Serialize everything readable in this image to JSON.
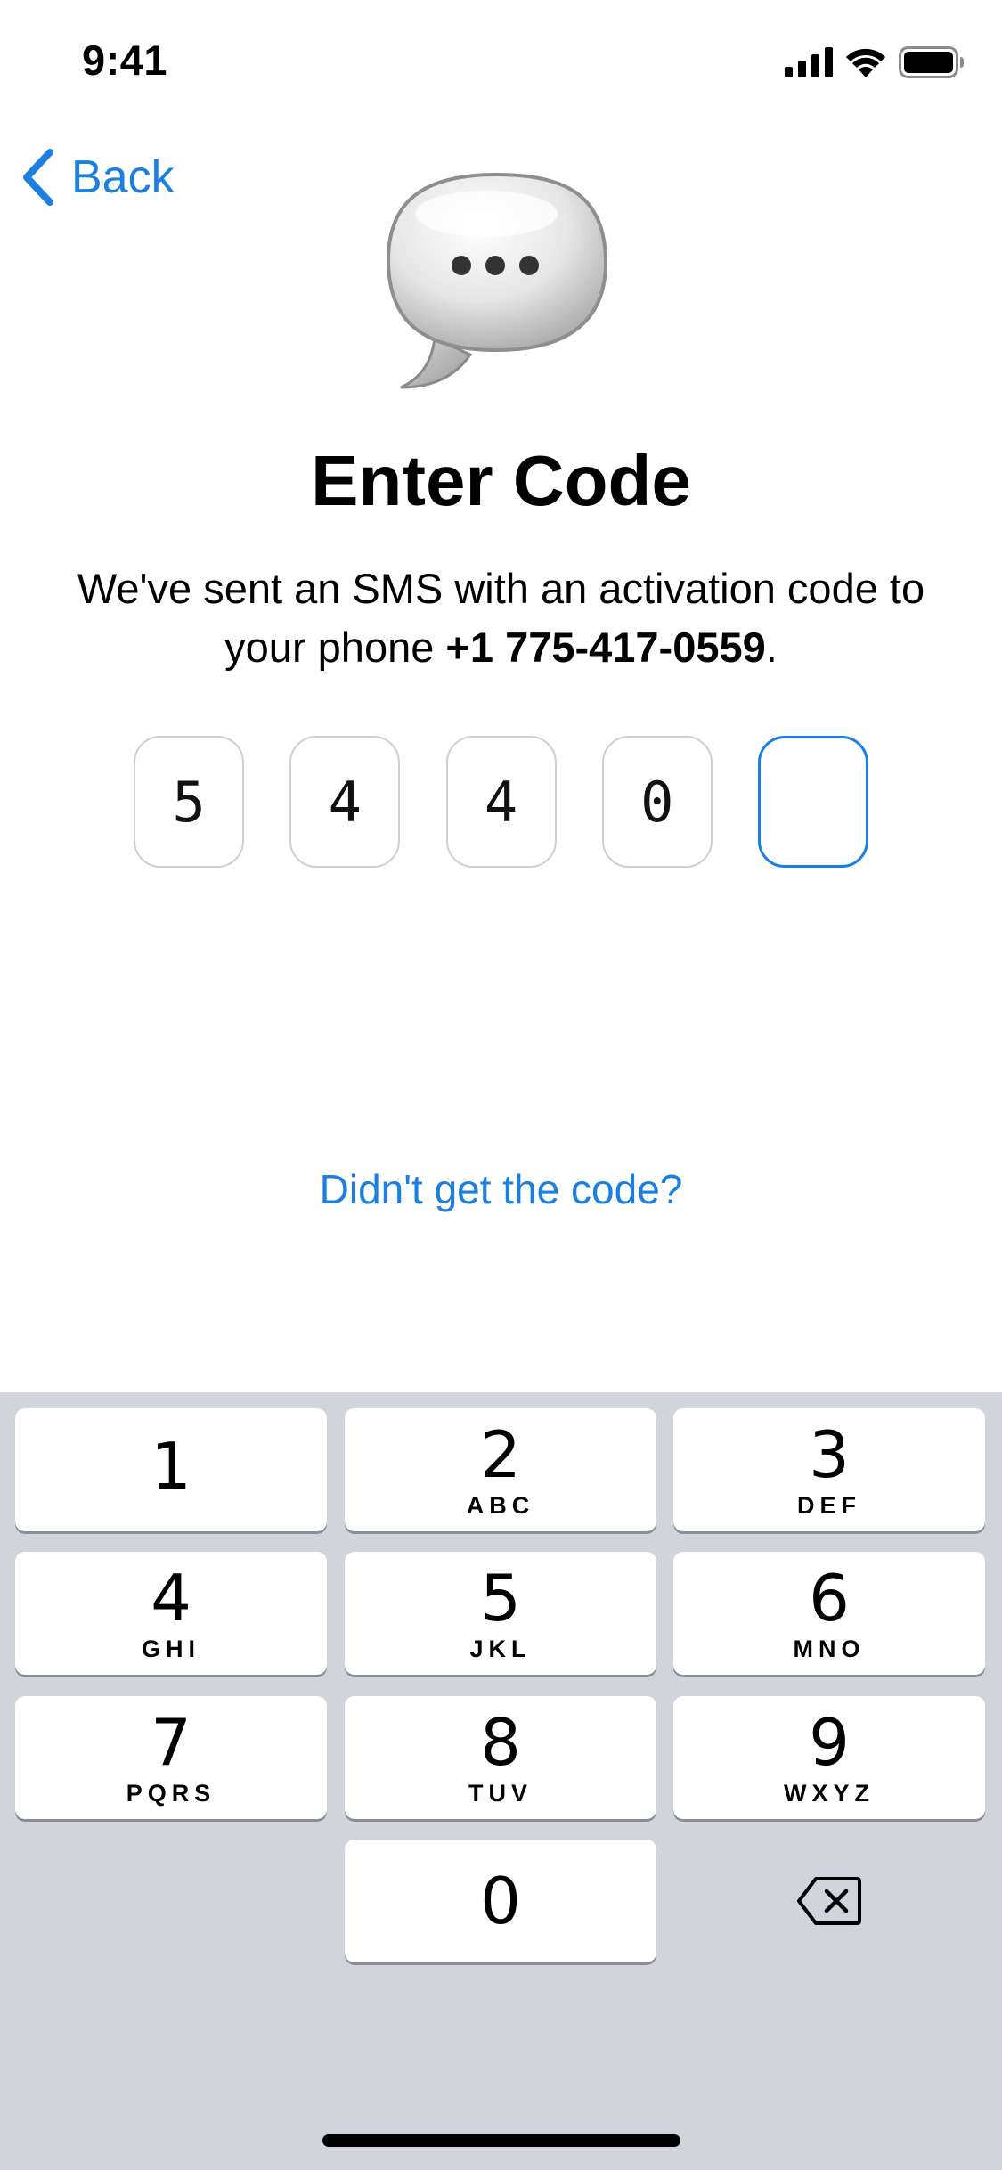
{
  "status_bar": {
    "time": "9:41"
  },
  "nav": {
    "back_label": "Back"
  },
  "header": {
    "title": "Enter Code",
    "subtitle_prefix": "We've sent an SMS with an activation code to your phone ",
    "phone_number": "+1 775-417-0559",
    "subtitle_suffix": "."
  },
  "code": {
    "digits": [
      "5",
      "4",
      "4",
      "0",
      ""
    ],
    "active_index": 4
  },
  "resend": {
    "label": "Didn't get the code?"
  },
  "keypad": {
    "keys": [
      {
        "digit": "1",
        "letters": ""
      },
      {
        "digit": "2",
        "letters": "ABC"
      },
      {
        "digit": "3",
        "letters": "DEF"
      },
      {
        "digit": "4",
        "letters": "GHI"
      },
      {
        "digit": "5",
        "letters": "JKL"
      },
      {
        "digit": "6",
        "letters": "MNO"
      },
      {
        "digit": "7",
        "letters": "PQRS"
      },
      {
        "digit": "8",
        "letters": "TUV"
      },
      {
        "digit": "9",
        "letters": "WXYZ"
      },
      {
        "digit": "0",
        "letters": ""
      }
    ],
    "backspace_icon": "delete-left-icon"
  },
  "colors": {
    "accent": "#1a7fe0",
    "keypad_background": "#d1d4db",
    "code_box_border": "#cfcfcf"
  }
}
